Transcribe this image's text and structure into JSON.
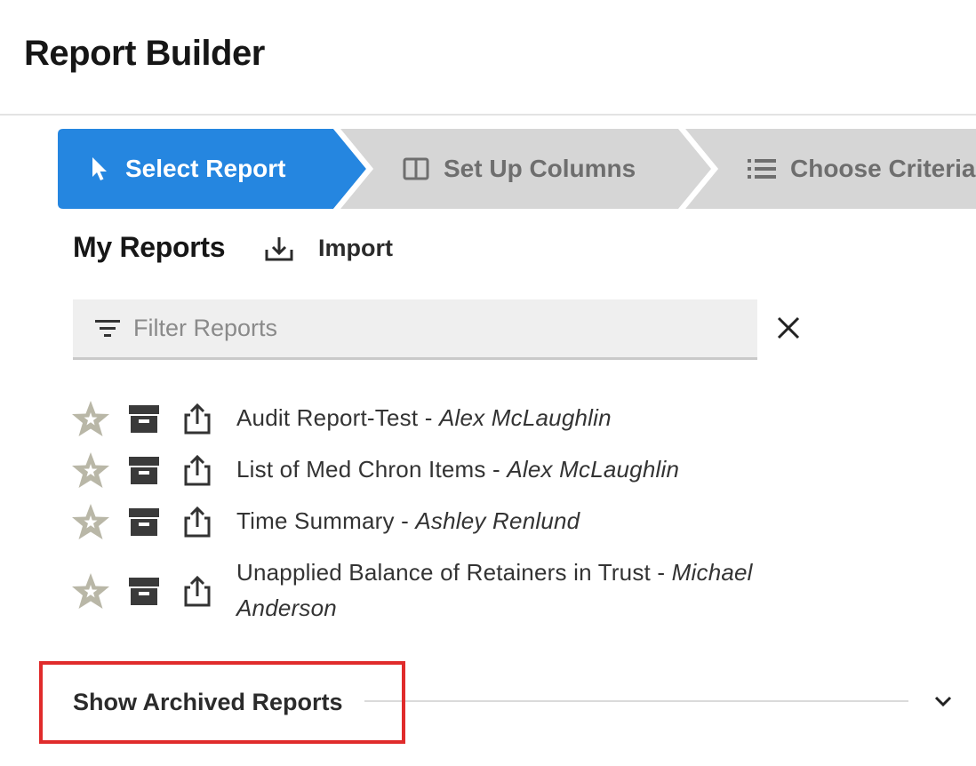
{
  "header": {
    "title": "Report Builder"
  },
  "stepper": {
    "steps": [
      {
        "label": "Select Report",
        "icon": "cursor-icon",
        "state": "active"
      },
      {
        "label": "Set Up Columns",
        "icon": "columns-icon",
        "state": "inactive"
      },
      {
        "label": "Choose Criteria",
        "icon": "list-icon",
        "state": "inactive"
      }
    ]
  },
  "my_reports": {
    "title": "My Reports",
    "import_label": "Import"
  },
  "filter": {
    "placeholder": "Filter Reports",
    "value": ""
  },
  "reports": [
    {
      "name": "Audit Report-Test",
      "separator": " - ",
      "author": "Alex McLaughlin"
    },
    {
      "name": "List of Med Chron Items",
      "separator": " - ",
      "author": "Alex McLaughlin"
    },
    {
      "name": "Time Summary",
      "separator": " - ",
      "author": "Ashley Renlund"
    },
    {
      "name": "Unapplied Balance of Retainers in Trust",
      "separator": " - ",
      "author": "Michael Anderson"
    }
  ],
  "archived": {
    "label": "Show Archived Reports"
  },
  "colors": {
    "active_step": "#2586e0",
    "inactive_step": "#d6d6d6",
    "star": "#b9b7a7",
    "highlight": "#e02b2b"
  }
}
